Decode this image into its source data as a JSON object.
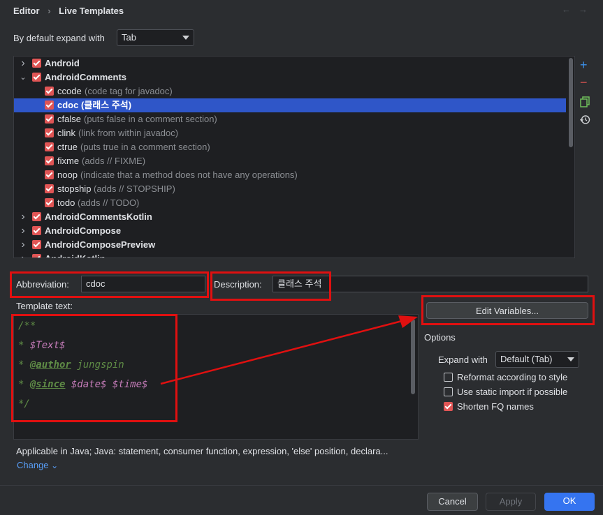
{
  "header": {
    "breadcrumb_root": "Editor",
    "breadcrumb_sep": "›",
    "breadcrumb_current": "Live Templates",
    "back_glyph": "←",
    "forward_glyph": "→"
  },
  "expand_default": {
    "label": "By default expand with",
    "value": "Tab"
  },
  "tree": {
    "rows": [
      {
        "type": "group",
        "expanded": false,
        "name": "Android",
        "desc": ""
      },
      {
        "type": "group",
        "expanded": true,
        "name": "AndroidComments",
        "desc": ""
      },
      {
        "type": "item",
        "name": "ccode",
        "desc": "(code tag for javadoc)"
      },
      {
        "type": "item",
        "name": "cdoc",
        "desc": "(클래스 주석)",
        "selected": true
      },
      {
        "type": "item",
        "name": "cfalse",
        "desc": "(puts false in a comment section)"
      },
      {
        "type": "item",
        "name": "clink",
        "desc": "(link from within javadoc)"
      },
      {
        "type": "item",
        "name": "ctrue",
        "desc": "(puts true in a comment section)"
      },
      {
        "type": "item",
        "name": "fixme",
        "desc": "(adds // FIXME)"
      },
      {
        "type": "item",
        "name": "noop",
        "desc": "(indicate that a method does not have any operations)"
      },
      {
        "type": "item",
        "name": "stopship",
        "desc": "(adds // STOPSHIP)"
      },
      {
        "type": "item",
        "name": "todo",
        "desc": "(adds // TODO)"
      },
      {
        "type": "group",
        "expanded": false,
        "name": "AndroidCommentsKotlin",
        "desc": ""
      },
      {
        "type": "group",
        "expanded": false,
        "name": "AndroidCompose",
        "desc": ""
      },
      {
        "type": "group",
        "expanded": false,
        "name": "AndroidComposePreview",
        "desc": ""
      },
      {
        "type": "group",
        "expanded": false,
        "name": "AndroidKotlin",
        "desc": ""
      }
    ]
  },
  "side_toolbar": {
    "add_glyph": "+",
    "remove_glyph": "−",
    "copy_icon": "copy-icon",
    "restore_icon": "restore-icon"
  },
  "abbreviation": {
    "label": "Abbreviation:",
    "value": "cdoc"
  },
  "description": {
    "label": "Description:",
    "value": "클래스 주석"
  },
  "template_text": {
    "label": "Template text:",
    "line1": "/**",
    "line2_prefix": "* ",
    "line2_var": "$Text$",
    "line3_prefix": "* ",
    "line3_tag": "@author",
    "line3_rest": " jungspin",
    "line4_prefix": "* ",
    "line4_tag": "@since",
    "line4_var1": " $date$",
    "line4_var2": " $time$",
    "line5": "*/"
  },
  "edit_variables": {
    "label": "Edit Variables..."
  },
  "options": {
    "title": "Options",
    "expand_label": "Expand with",
    "expand_value": "Default (Tab)",
    "reformat_label": "Reformat according to style",
    "reformat_checked": false,
    "static_import_label": "Use static import if possible",
    "static_import_checked": false,
    "shorten_label": "Shorten FQ names",
    "shorten_checked": true
  },
  "applicable": {
    "text": "Applicable in Java; Java: statement, consumer function, expression, 'else' position, declara...",
    "change_label": "Change",
    "change_glyph": "⌄"
  },
  "footer": {
    "cancel": "Cancel",
    "apply": "Apply",
    "ok": "OK"
  },
  "colors": {
    "background": "#2b2d30",
    "field_bg": "#1e1f22",
    "selection": "#2f56c8",
    "checkbox": "#e05555",
    "annotation_red": "#e01010",
    "link": "#589df6",
    "primary_button": "#3574f0"
  }
}
